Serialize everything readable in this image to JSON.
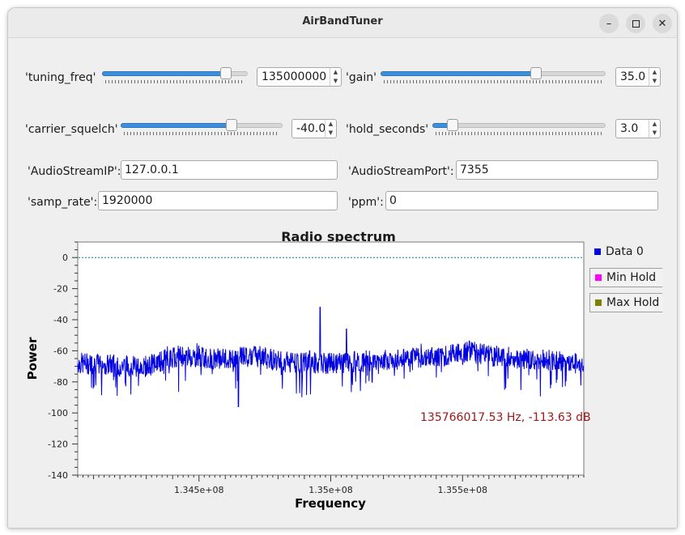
{
  "window": {
    "title": "AirBandTuner"
  },
  "controls": {
    "tuning_freq": {
      "label": "'tuning_freq'",
      "value": "135000000",
      "slider_fraction": 0.88
    },
    "gain": {
      "label": "'gain'",
      "value": "35.0",
      "slider_fraction": 0.7
    },
    "carrier_squelch": {
      "label": "'carrier_squelch'",
      "value": "-40.0",
      "slider_fraction": 0.7
    },
    "hold_seconds": {
      "label": "'hold_seconds'",
      "value": "3.0",
      "slider_fraction": 0.09
    }
  },
  "fields": {
    "audio_ip": {
      "label": "'AudioStreamIP':",
      "value": "127.0.0.1"
    },
    "audio_port": {
      "label": "'AudioStreamPort':",
      "value": "7355"
    },
    "samp_rate": {
      "label": "'samp_rate':",
      "value": "1920000"
    },
    "ppm": {
      "label": "'ppm':",
      "value": "0"
    }
  },
  "legend": [
    {
      "label": "Data 0",
      "color": "#0000e0"
    },
    {
      "label": "Min Hold",
      "color": "#ff00ff"
    },
    {
      "label": "Max Hold",
      "color": "#808000"
    }
  ],
  "chart_data": {
    "type": "line",
    "title": "Radio spectrum",
    "xlabel": "Frequency",
    "ylabel": "Power",
    "x_tick_labels": [
      "1.345e+08",
      "1.35e+08",
      "1.355e+08"
    ],
    "x_ticks": [
      134500000,
      135000000,
      135500000
    ],
    "y_ticks": [
      0,
      -20,
      -40,
      -60,
      -80,
      -100,
      -120,
      -140
    ],
    "xlim": [
      134040000,
      135960000
    ],
    "ylim": [
      -140,
      10
    ],
    "threshold_line": 0,
    "marker_readout": "135766017.53 Hz, -113.63 dB",
    "series": [
      {
        "name": "Data 0",
        "color": "#0000e0",
        "noise_floor_points": [
          {
            "x": 134040000,
            "y": -68
          },
          {
            "x": 134300000,
            "y": -70
          },
          {
            "x": 134420000,
            "y": -63
          },
          {
            "x": 134620000,
            "y": -66
          },
          {
            "x": 134680000,
            "y": -62
          },
          {
            "x": 134850000,
            "y": -68
          },
          {
            "x": 135000000,
            "y": -68
          },
          {
            "x": 135200000,
            "y": -66
          },
          {
            "x": 135440000,
            "y": -63
          },
          {
            "x": 135520000,
            "y": -60
          },
          {
            "x": 135640000,
            "y": -64
          },
          {
            "x": 135960000,
            "y": -68
          }
        ],
        "peaks": [
          {
            "x": 134960000,
            "y": -32
          },
          {
            "x": 135060000,
            "y": -46
          },
          {
            "x": 134920000,
            "y": -60
          },
          {
            "x": 134650000,
            "y": -96
          }
        ]
      }
    ]
  }
}
